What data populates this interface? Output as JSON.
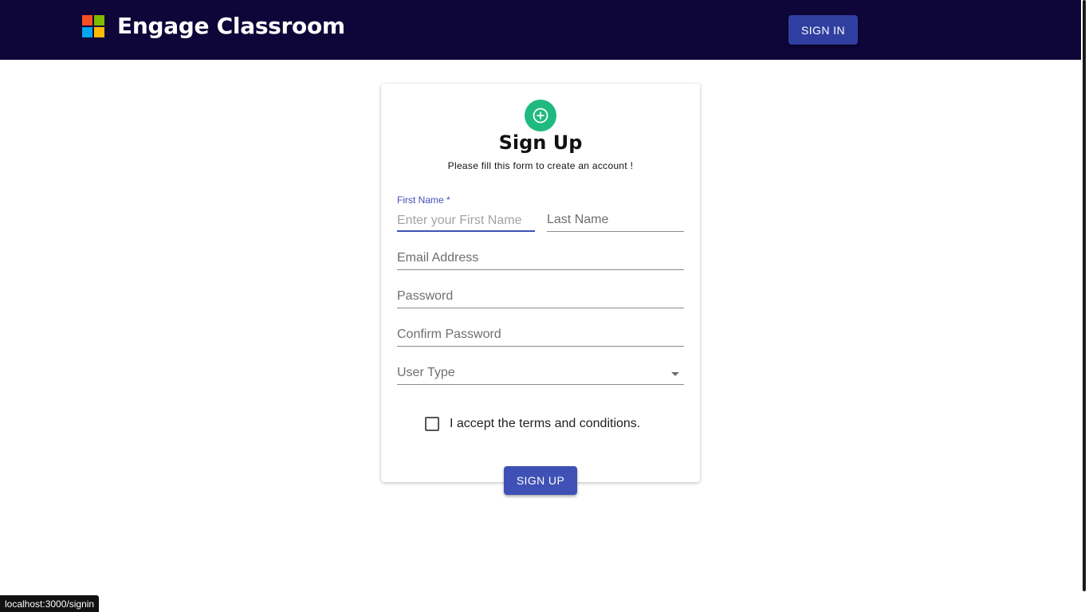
{
  "header": {
    "title": "Engage Classroom",
    "sign_in_label": "SIGN IN",
    "logo_colors": [
      "#f25022",
      "#7fba00",
      "#00a4ef",
      "#ffb900"
    ]
  },
  "form": {
    "title": "Sign Up",
    "subtitle": "Please fill this form to create an account !",
    "first_name": {
      "label": "First Name *",
      "placeholder": "Enter your First Name",
      "value": ""
    },
    "last_name": {
      "label": "Last Name",
      "value": ""
    },
    "email": {
      "label": "Email Address",
      "value": ""
    },
    "password": {
      "label": "Password",
      "value": ""
    },
    "confirm_password": {
      "label": "Confirm Password",
      "value": ""
    },
    "user_type": {
      "label": "User Type",
      "value": ""
    },
    "terms_label": "I accept the terms and conditions.",
    "terms_checked": false,
    "submit_label": "SIGN UP",
    "accent_color": "#3f51b5",
    "avatar_color": "#1fba7f"
  },
  "status_bar": {
    "url": "localhost:3000/signin"
  }
}
